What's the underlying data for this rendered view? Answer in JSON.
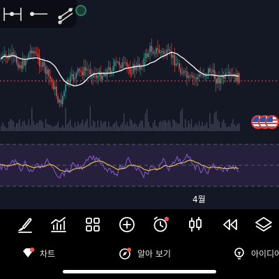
{
  "colors": {
    "background": "#141824",
    "candle_up": "#26a69a",
    "candle_down": "#ef5350",
    "ma_line": "#ffffff",
    "rsi_line": "#7e57c2",
    "rsi_ma": "#f2c94c",
    "rsi_band": "#2b2344",
    "price_dotted": "#ef5350",
    "toolbar_icon": "#ffffff",
    "notification_dot": "#ef5350"
  },
  "chart": {
    "time_label": "4월",
    "flags_icon": "us-flag-icon"
  },
  "chart_data": {
    "type": "candlestick",
    "title": "",
    "xlabel": "",
    "ylabel": "",
    "grid": false,
    "x_ticks": [
      "4월"
    ],
    "indicators": [
      "moving-average",
      "rsi"
    ]
  },
  "toolbar": {
    "items": [
      {
        "name": "draw-brush",
        "icon": "brush-icon"
      },
      {
        "name": "indicators",
        "icon": "indicators-icon"
      },
      {
        "name": "layouts",
        "icon": "grid-icon"
      },
      {
        "name": "add",
        "icon": "plus-circle-icon"
      },
      {
        "name": "alert",
        "icon": "alarm-clock-icon"
      },
      {
        "name": "chart-type",
        "icon": "candles-icon"
      },
      {
        "name": "replay",
        "icon": "rewind-icon"
      },
      {
        "name": "layers",
        "icon": "layers-icon"
      }
    ]
  },
  "bottom_nav": {
    "chart_label": "차트",
    "learn_label": "알아 보기",
    "ideas_label": "아이디어"
  }
}
